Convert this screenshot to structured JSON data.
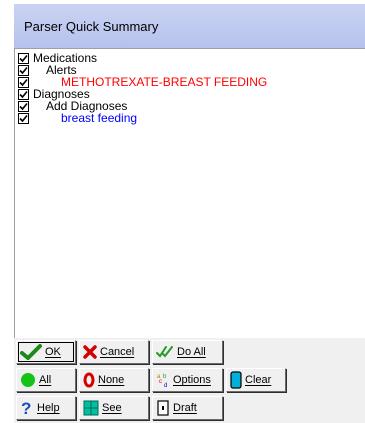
{
  "window": {
    "title": "Parser Quick Summary"
  },
  "items": [
    {
      "label": "Medications",
      "indent": 0,
      "checked": true,
      "color": "#000000"
    },
    {
      "label": "Alerts",
      "indent": 1,
      "checked": true,
      "color": "#000000"
    },
    {
      "label": "METHOTREXATE-BREAST FEEDING",
      "indent": 2,
      "checked": true,
      "color": "#ff0000"
    },
    {
      "label": "Diagnoses",
      "indent": 0,
      "checked": true,
      "color": "#000000"
    },
    {
      "label": "Add Diagnoses",
      "indent": 1,
      "checked": true,
      "color": "#000000"
    },
    {
      "label": "breast feeding",
      "indent": 2,
      "checked": true,
      "color": "#0000ff"
    }
  ],
  "buttons": {
    "ok": "OK",
    "cancel": "Cancel",
    "do_all": "Do All",
    "all": "All",
    "none": "None",
    "options": "Options",
    "clear": "Clear",
    "help": "Help",
    "see": "See",
    "draft": "Draft"
  },
  "icons": {
    "ok": "check-icon",
    "cancel": "x-icon",
    "do_all": "double-check-icon",
    "all": "green-circle-icon",
    "none": "zero-icon",
    "options": "abc-icon",
    "clear": "cylinder-icon",
    "help": "question-icon",
    "see": "grid-icon",
    "draft": "draft-icon"
  }
}
